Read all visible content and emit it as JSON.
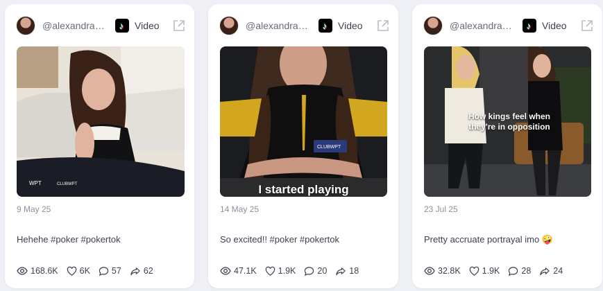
{
  "cards": [
    {
      "handle": "@alexandrabo...",
      "type_label": "Video",
      "date": "9 May 25",
      "caption": "Hehehe #poker #pokertok",
      "views": "168.6K",
      "likes": "6K",
      "comments": "57",
      "shares": "62",
      "overlay": ""
    },
    {
      "handle": "@alexandrabo...",
      "type_label": "Video",
      "date": "14 May 25",
      "caption": "So excited!! #poker #pokertok",
      "views": "47.1K",
      "likes": "1.9K",
      "comments": "20",
      "shares": "18",
      "overlay": "I started playing"
    },
    {
      "handle": "@alexandrabo...",
      "type_label": "Video",
      "date": "23 Jul 25",
      "caption": "Pretty accruate portrayal imo 🤪",
      "views": "32.8K",
      "likes": "1.9K",
      "comments": "28",
      "shares": "24",
      "overlay": "How kings feel when they're in opposition"
    }
  ],
  "colors": {
    "background": "#eef0f5",
    "card": "#ffffff",
    "text": "#3d4150",
    "muted": "#8c91a0"
  }
}
